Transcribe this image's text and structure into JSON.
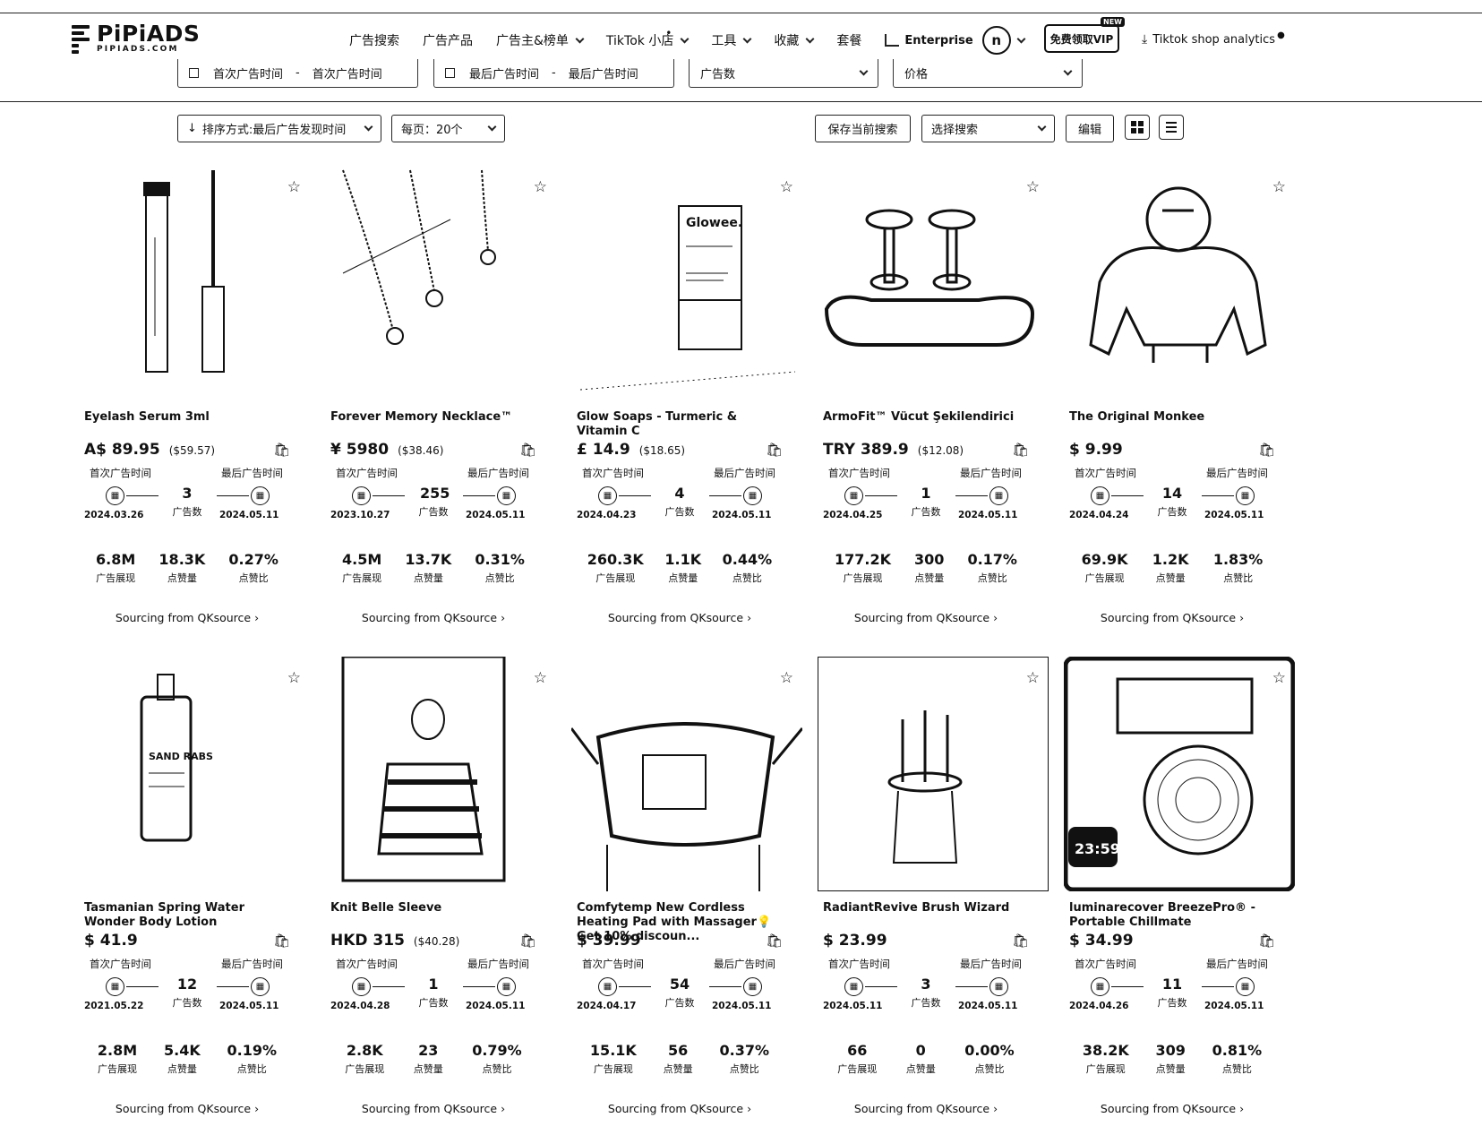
{
  "header": {
    "logo_main": "PiPiADS",
    "logo_sub": "PIPIADS.COM",
    "nav": [
      {
        "label": "广告搜索",
        "chevron": false,
        "dot": false
      },
      {
        "label": "广告产品",
        "chevron": false,
        "dot": false
      },
      {
        "label": "广告主&榜单",
        "chevron": true,
        "dot": false
      },
      {
        "label": "TikTok 小店",
        "chevron": true,
        "dot": true
      },
      {
        "label": "工具",
        "chevron": true,
        "dot": false
      },
      {
        "label": "收藏",
        "chevron": true,
        "dot": false
      },
      {
        "label": "套餐",
        "chevron": false,
        "dot": false
      }
    ],
    "enterprise": "Enterprise",
    "avatar_letter": "n",
    "vip_label": "免费领取VIP",
    "vip_tag": "NEW",
    "tiktok_shop": "Tiktok shop analytics"
  },
  "filters": {
    "first_ad_start": "首次广告时间",
    "first_ad_end": "首次广告时间",
    "last_ad_start": "最后广告时间",
    "last_ad_end": "最后广告时间",
    "ad_count": "广告数",
    "price": "价格",
    "dash": "-"
  },
  "toolbar": {
    "sort": "排序方式:最后广告发现时间",
    "per_page": "每页：20个",
    "save_search": "保存当前搜索",
    "select_search": "选择搜索",
    "edit": "编辑"
  },
  "labels": {
    "first_time": "首次广告时间",
    "last_time": "最后广告时间",
    "ad_count": "广告数",
    "impressions": "广告展现",
    "likes": "点赞量",
    "like_rate": "点赞比",
    "sourcing": "Sourcing from QKsource",
    "source_arrow": "›"
  },
  "products": [
    {
      "name": "Eyelash Serum 3ml",
      "price": "A$ 89.95",
      "usd": "($59.57)",
      "count": "3",
      "first": "2024.03.26",
      "last": "2024.05.11",
      "impr": "6.8M",
      "likes": "18.3K",
      "rate": "0.27%"
    },
    {
      "name": "Forever Memory Necklace™",
      "price": "¥ 5980",
      "usd": "($38.46)",
      "count": "255",
      "first": "2023.10.27",
      "last": "2024.05.11",
      "impr": "4.5M",
      "likes": "13.7K",
      "rate": "0.31%"
    },
    {
      "name": "Glow Soaps - Turmeric & Vitamin C",
      "price": "£ 14.9",
      "usd": "($18.65)",
      "count": "4",
      "first": "2024.04.23",
      "last": "2024.05.11",
      "impr": "260.3K",
      "likes": "1.1K",
      "rate": "0.44%"
    },
    {
      "name": "ArmoFit™ Vücut Şekilendirici",
      "price": "TRY 389.9",
      "usd": "($12.08)",
      "count": "1",
      "first": "2024.04.25",
      "last": "2024.05.11",
      "impr": "177.2K",
      "likes": "300",
      "rate": "0.17%"
    },
    {
      "name": "The Original Monkee",
      "price": "$ 9.99",
      "usd": "",
      "count": "14",
      "first": "2024.04.24",
      "last": "2024.05.11",
      "impr": "69.9K",
      "likes": "1.2K",
      "rate": "1.83%"
    },
    {
      "name": "Tasmanian Spring Water Wonder Body Lotion",
      "price": "$ 41.9",
      "usd": "",
      "count": "12",
      "first": "2021.05.22",
      "last": "2024.05.11",
      "impr": "2.8M",
      "likes": "5.4K",
      "rate": "0.19%"
    },
    {
      "name": "Knit Belle Sleeve",
      "price": "HKD 315",
      "usd": "($40.28)",
      "count": "1",
      "first": "2024.04.28",
      "last": "2024.05.11",
      "impr": "2.8K",
      "likes": "23",
      "rate": "0.79%"
    },
    {
      "name": "Comfytemp New Cordless Heating Pad with Massager💡Get 10% discoun...",
      "price": "$ 39.99",
      "usd": "",
      "count": "54",
      "first": "2024.04.17",
      "last": "2024.05.11",
      "impr": "15.1K",
      "likes": "56",
      "rate": "0.37%"
    },
    {
      "name": "RadiantRevive Brush Wizard",
      "price": "$ 23.99",
      "usd": "",
      "count": "3",
      "first": "2024.05.11",
      "last": "2024.05.11",
      "impr": "66",
      "likes": "0",
      "rate": "0.00%"
    },
    {
      "name": "luminarecover BreezePro® - Portable Chillmate",
      "price": "$ 34.99",
      "usd": "",
      "count": "11",
      "first": "2024.04.26",
      "last": "2024.05.11",
      "impr": "38.2K",
      "likes": "309",
      "rate": "0.81%"
    }
  ],
  "thumb_texts": {
    "glowee": "Glowee.",
    "clock": "23:59",
    "sand": "SAND RABS"
  }
}
